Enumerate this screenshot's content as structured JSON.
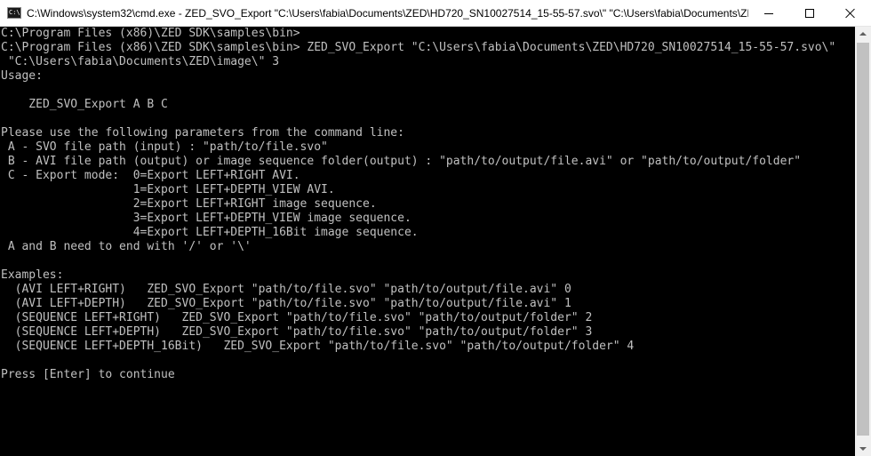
{
  "window": {
    "title": "C:\\Windows\\system32\\cmd.exe - ZED_SVO_Export  \"C:\\Users\\fabia\\Documents\\ZED\\HD720_SN10027514_15-55-57.svo\\\" \"C:\\Users\\fabia\\Documents\\ZE...",
    "app_icon_glyph": "C:\\",
    "controls": {
      "minimize": "minimize-icon",
      "maximize": "maximize-icon",
      "close": "close-icon"
    }
  },
  "console": {
    "text_color": "#c0c0c0",
    "background": "#000000",
    "lines": [
      "C:\\Program Files (x86)\\ZED SDK\\samples\\bin>",
      "C:\\Program Files (x86)\\ZED SDK\\samples\\bin> ZED_SVO_Export \"C:\\Users\\fabia\\Documents\\ZED\\HD720_SN10027514_15-55-57.svo\\\"",
      " \"C:\\Users\\fabia\\Documents\\ZED\\image\\\" 3",
      "Usage:",
      "",
      "    ZED_SVO_Export A B C",
      "",
      "Please use the following parameters from the command line:",
      " A - SVO file path (input) : \"path/to/file.svo\"",
      " B - AVI file path (output) or image sequence folder(output) : \"path/to/output/file.avi\" or \"path/to/output/folder\"",
      " C - Export mode:  0=Export LEFT+RIGHT AVI.",
      "                   1=Export LEFT+DEPTH_VIEW AVI.",
      "                   2=Export LEFT+RIGHT image sequence.",
      "                   3=Export LEFT+DEPTH_VIEW image sequence.",
      "                   4=Export LEFT+DEPTH_16Bit image sequence.",
      " A and B need to end with '/' or '\\'",
      "",
      "Examples:",
      "  (AVI LEFT+RIGHT)   ZED_SVO_Export \"path/to/file.svo\" \"path/to/output/file.avi\" 0",
      "  (AVI LEFT+DEPTH)   ZED_SVO_Export \"path/to/file.svo\" \"path/to/output/file.avi\" 1",
      "  (SEQUENCE LEFT+RIGHT)   ZED_SVO_Export \"path/to/file.svo\" \"path/to/output/folder\" 2",
      "  (SEQUENCE LEFT+DEPTH)   ZED_SVO_Export \"path/to/file.svo\" \"path/to/output/folder\" 3",
      "  (SEQUENCE LEFT+DEPTH_16Bit)   ZED_SVO_Export \"path/to/file.svo\" \"path/to/output/folder\" 4",
      "",
      "Press [Enter] to continue"
    ]
  },
  "scrollbar": {
    "up_icon": "scroll-up-arrow-icon",
    "down_icon": "scroll-down-arrow-icon"
  }
}
